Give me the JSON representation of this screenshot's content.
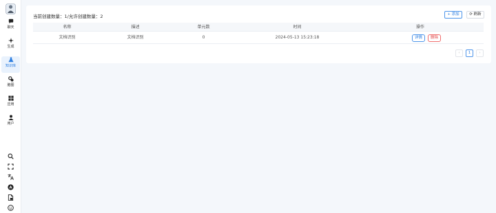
{
  "sidebar": {
    "items": [
      {
        "label": "聊天",
        "icon": "chat-icon"
      },
      {
        "label": "生成",
        "icon": "sparkle-icon"
      },
      {
        "label": "知识库",
        "icon": "flask-icon",
        "active": true
      },
      {
        "label": "脑图",
        "icon": "mindmap-icon"
      },
      {
        "label": "应用",
        "icon": "apps-icon"
      },
      {
        "label": "用户",
        "icon": "user-icon"
      }
    ],
    "tools": [
      "search-icon",
      "fullscreen-icon",
      "translate-icon",
      "openai-icon",
      "document-icon",
      "smile-icon"
    ]
  },
  "toolbar": {
    "count_text": "当前创建数量：1/允许创建数量：2",
    "add_label": "+ 添加",
    "refresh_label": "⟳ 刷新"
  },
  "table": {
    "headers": [
      "名称",
      "描述",
      "单元数",
      "时间",
      "操作"
    ],
    "rows": [
      {
        "name": "文档识别",
        "desc": "文档识别",
        "units": "0",
        "time": "2024-05-13 15:23:18",
        "detail": "详情",
        "delete": "删除"
      }
    ]
  },
  "pagination": {
    "prev": "‹",
    "page": "1",
    "next": "›"
  },
  "colors": {
    "accent": "#2f7fe0",
    "danger": "#e04848",
    "page_bg": "#f4f7fb"
  }
}
